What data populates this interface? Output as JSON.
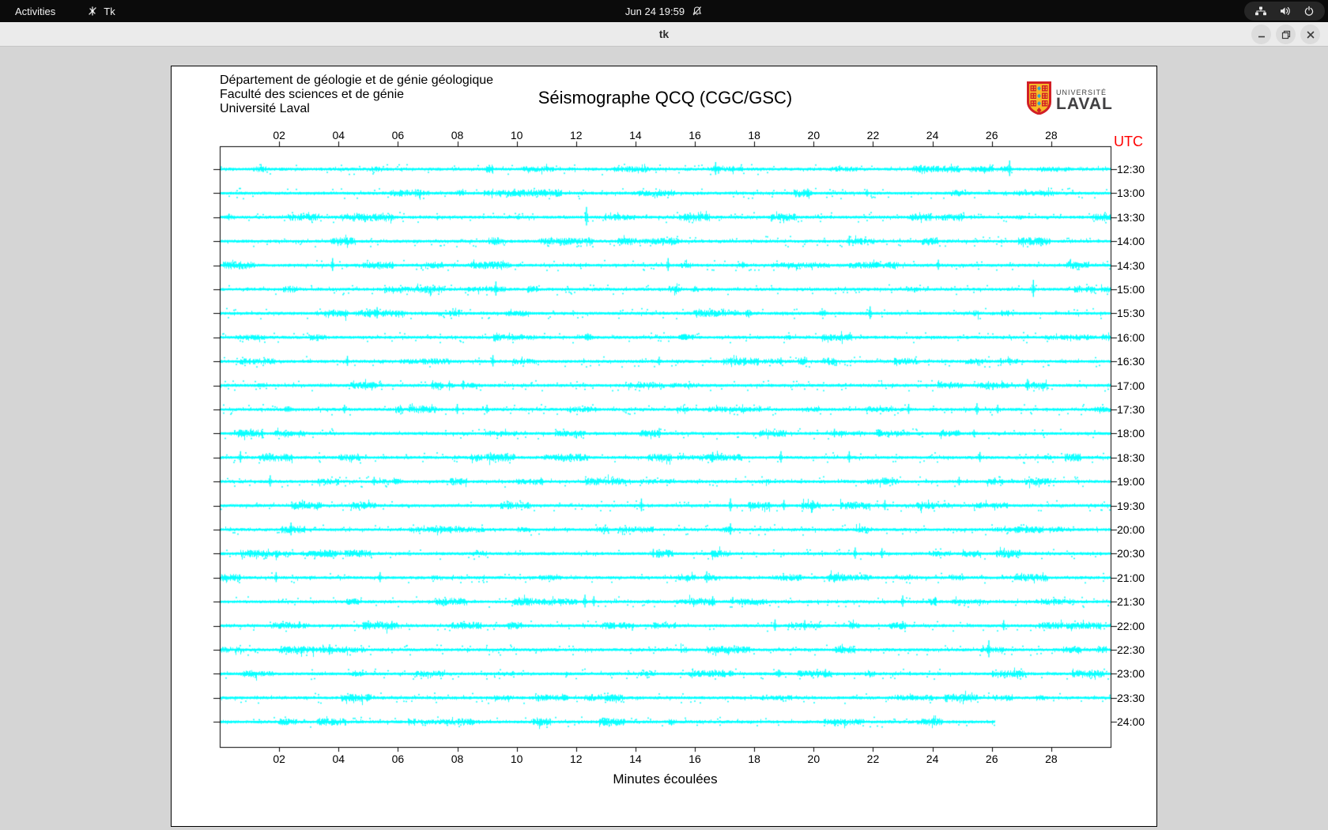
{
  "topbar": {
    "activities_label": "Activities",
    "app_label": "Tk",
    "clock": "Jun 24 19:59",
    "icons": [
      "tk-icon",
      "bell-slash-icon",
      "wired-network-icon",
      "volume-icon",
      "power-icon"
    ]
  },
  "titlebar": {
    "title": "tk",
    "buttons": [
      "minimize",
      "maximize",
      "close"
    ]
  },
  "window": {
    "header_lines": [
      "Département de géologie et de génie géologique",
      "Faculté des sciences et de génie",
      "Université Laval"
    ],
    "logo": {
      "line1": "UNIVERSITÉ",
      "line2": "LAVAL"
    }
  },
  "chart_data": {
    "type": "line",
    "subtype": "helicorder-seismogram",
    "title": "Séismographe QCQ (CGC/GSC)",
    "xlabel": "Minutes écoulées",
    "right_axis_label": "UTC",
    "x_range": [
      0,
      30
    ],
    "x_ticks": [
      "02",
      "04",
      "06",
      "08",
      "10",
      "12",
      "14",
      "16",
      "18",
      "20",
      "22",
      "24",
      "26",
      "28"
    ],
    "grid": false,
    "trace_color": "#00ffff",
    "utc_color": "#ff0000",
    "rows": [
      {
        "utc": "12:30",
        "events": [
          {
            "t": 16.7,
            "a": 9
          },
          {
            "t": 26.6,
            "a": 11
          }
        ]
      },
      {
        "utc": "13:00",
        "events": [
          {
            "t": 19.8,
            "a": 6
          },
          {
            "t": 21.8,
            "a": 5
          }
        ]
      },
      {
        "utc": "13:30",
        "events": [
          {
            "t": 0.3,
            "a": 5,
            "w": 1
          },
          {
            "t": 12.35,
            "a": 13
          }
        ]
      },
      {
        "utc": "14:00",
        "events": [
          {
            "t": 21.2,
            "a": 7
          }
        ]
      },
      {
        "utc": "14:30",
        "events": [
          {
            "t": 3.8,
            "a": 9
          },
          {
            "t": 15.1,
            "a": 9
          },
          {
            "t": 17.6,
            "a": 5,
            "w": 1
          },
          {
            "t": 22.1,
            "a": 6,
            "w": 1
          },
          {
            "t": 24.2,
            "a": 7
          }
        ]
      },
      {
        "utc": "15:00",
        "events": [
          {
            "t": 9.3,
            "a": 10
          },
          {
            "t": 27.4,
            "a": 12
          }
        ]
      },
      {
        "utc": "15:30",
        "events": [
          {
            "t": 5.3,
            "a": 8
          },
          {
            "t": 20.3,
            "a": 6,
            "w": 1
          },
          {
            "t": 21.9,
            "a": 9
          }
        ]
      },
      {
        "utc": "16:00",
        "events": [
          {
            "t": 12.4,
            "a": 6,
            "w": 1
          },
          {
            "t": 15.6,
            "a": 7,
            "w": 1
          }
        ]
      },
      {
        "utc": "16:30",
        "events": [
          {
            "t": 4.3,
            "a": 7
          },
          {
            "t": 9.2,
            "a": 8
          },
          {
            "t": 14.8,
            "a": 6
          },
          {
            "t": 18.9,
            "a": 5
          }
        ]
      },
      {
        "utc": "17:00",
        "events": [
          {
            "t": 1.4,
            "a": 5,
            "w": 1
          },
          {
            "t": 8.2,
            "a": 6
          },
          {
            "t": 27.2,
            "a": 8
          }
        ]
      },
      {
        "utc": "17:30",
        "events": [
          {
            "t": 2.3,
            "a": 6,
            "w": 1
          },
          {
            "t": 4.2,
            "a": 6
          },
          {
            "t": 8.0,
            "a": 7
          },
          {
            "t": 9.0,
            "a": 6
          },
          {
            "t": 23.2,
            "a": 7
          },
          {
            "t": 25.5,
            "a": 8
          },
          {
            "t": 26.2,
            "a": 6
          }
        ]
      },
      {
        "utc": "18:00",
        "events": [
          {
            "t": 14.8,
            "a": 7
          },
          {
            "t": 20.7,
            "a": 6
          },
          {
            "t": 22.2,
            "a": 6,
            "w": 1
          },
          {
            "t": 24.8,
            "a": 5,
            "w": 1
          },
          {
            "t": 25.4,
            "a": 5
          }
        ]
      },
      {
        "utc": "18:30",
        "events": [
          {
            "t": 0.7,
            "a": 8
          },
          {
            "t": 16.6,
            "a": 7
          },
          {
            "t": 18.9,
            "a": 8
          },
          {
            "t": 21.2,
            "a": 8
          },
          {
            "t": 25.6,
            "a": 7
          }
        ]
      },
      {
        "utc": "19:00",
        "events": [
          {
            "t": 1.7,
            "a": 8
          },
          {
            "t": 5.2,
            "a": 6
          },
          {
            "t": 22.4,
            "a": 6,
            "w": 1
          },
          {
            "t": 24.9,
            "a": 6
          },
          {
            "t": 26.1,
            "a": 5
          }
        ]
      },
      {
        "utc": "19:30",
        "events": [
          {
            "t": 14.2,
            "a": 9
          },
          {
            "t": 17.2,
            "a": 9
          },
          {
            "t": 19.0,
            "a": 7
          },
          {
            "t": 22.4,
            "a": 7
          }
        ]
      },
      {
        "utc": "20:00",
        "events": [
          {
            "t": 2.4,
            "a": 9
          },
          {
            "t": 17.2,
            "a": 8
          }
        ]
      },
      {
        "utc": "20:30",
        "events": [
          {
            "t": 14.6,
            "a": 6
          },
          {
            "t": 21.4,
            "a": 8
          },
          {
            "t": 22.3,
            "a": 7
          }
        ]
      },
      {
        "utc": "21:00",
        "events": [
          {
            "t": 1.9,
            "a": 7
          },
          {
            "t": 5.4,
            "a": 7
          },
          {
            "t": 16.4,
            "a": 8
          }
        ]
      },
      {
        "utc": "21:30",
        "events": [
          {
            "t": 12.3,
            "a": 9
          },
          {
            "t": 12.6,
            "a": 7
          },
          {
            "t": 16.6,
            "a": 7
          },
          {
            "t": 23.0,
            "a": 8
          },
          {
            "t": 24.1,
            "a": 6
          }
        ]
      },
      {
        "utc": "22:00",
        "events": [
          {
            "t": 5.8,
            "a": 6
          },
          {
            "t": 18.7,
            "a": 8
          },
          {
            "t": 19.7,
            "a": 7
          },
          {
            "t": 26.4,
            "a": 7
          }
        ]
      },
      {
        "utc": "22:30",
        "events": [
          {
            "t": 3.7,
            "a": 7
          },
          {
            "t": 25.9,
            "a": 12
          }
        ]
      },
      {
        "utc": "23:00",
        "events": [
          {
            "t": 17.2,
            "a": 5,
            "w": 1
          },
          {
            "t": 18.8,
            "a": 6,
            "w": 1
          },
          {
            "t": 20.4,
            "a": 6
          }
        ]
      },
      {
        "utc": "23:30",
        "events": [
          {
            "t": 11.0,
            "a": 5,
            "w": 1
          },
          {
            "t": 11.6,
            "a": 5,
            "w": 1
          },
          {
            "t": 23.3,
            "a": 5,
            "w": 1
          }
        ]
      },
      {
        "utc": "24:00",
        "end": 26.1,
        "events": [
          {
            "t": 21.5,
            "a": 4,
            "w": 1
          }
        ]
      }
    ]
  }
}
